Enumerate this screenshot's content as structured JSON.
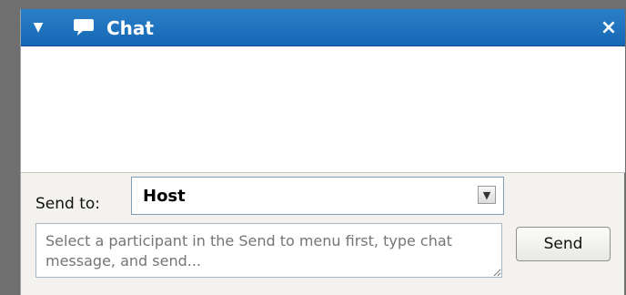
{
  "window": {
    "title": "Chat",
    "collapse_icon": "triangle-down-icon",
    "chat_icon": "speech-bubble-icon",
    "close_icon": "close-icon",
    "close_glyph": "×",
    "titlebar_color": "#1f73bf"
  },
  "compose": {
    "send_to_label": "Send to:",
    "recipient_selected": "Host",
    "message_placeholder": "Select a participant in the Send to menu first, type chat message, and send...",
    "send_button_label": "Send"
  }
}
